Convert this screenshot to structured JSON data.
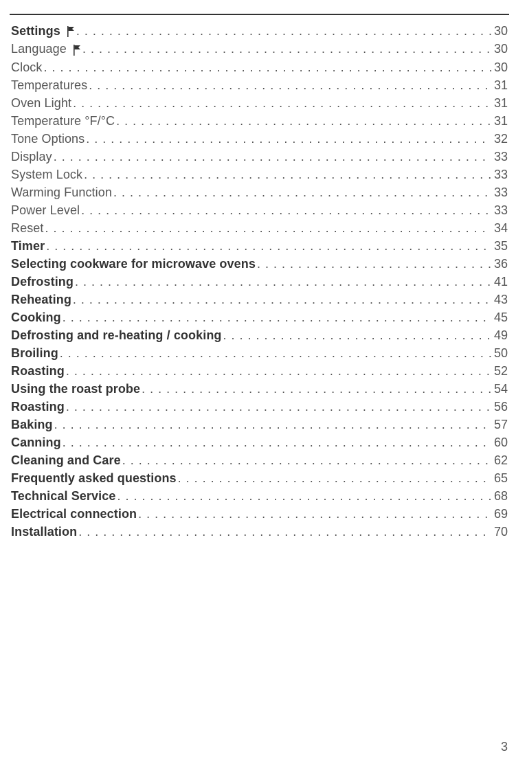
{
  "toc": [
    {
      "label": "Settings",
      "flag": true,
      "bold": true,
      "page": "30"
    },
    {
      "label": "Language",
      "flag": true,
      "bold": false,
      "page": "30"
    },
    {
      "label": "Clock",
      "flag": false,
      "bold": false,
      "page": "30"
    },
    {
      "label": "Temperatures",
      "flag": false,
      "bold": false,
      "page": "31"
    },
    {
      "label": "Oven Light",
      "flag": false,
      "bold": false,
      "page": "31"
    },
    {
      "label": "Temperature °F/°C",
      "flag": false,
      "bold": false,
      "page": "31"
    },
    {
      "label": "Tone Options",
      "flag": false,
      "bold": false,
      "page": "32"
    },
    {
      "label": "Display",
      "flag": false,
      "bold": false,
      "page": "33"
    },
    {
      "label": "System Lock",
      "flag": false,
      "bold": false,
      "page": "33"
    },
    {
      "label": "Warming Function",
      "flag": false,
      "bold": false,
      "page": "33"
    },
    {
      "label": "Power Level",
      "flag": false,
      "bold": false,
      "page": "33"
    },
    {
      "label": "Reset",
      "flag": false,
      "bold": false,
      "page": "34"
    },
    {
      "label": "Timer",
      "flag": false,
      "bold": true,
      "page": "35"
    },
    {
      "label": "Selecting cookware for microwave ovens",
      "flag": false,
      "bold": true,
      "page": "36"
    },
    {
      "label": "Defrosting",
      "flag": false,
      "bold": true,
      "page": "41"
    },
    {
      "label": "Reheating",
      "flag": false,
      "bold": true,
      "page": "43"
    },
    {
      "label": "Cooking",
      "flag": false,
      "bold": true,
      "page": "45"
    },
    {
      "label": "Defrosting and re-heating / cooking",
      "flag": false,
      "bold": true,
      "page": "49"
    },
    {
      "label": "Broiling",
      "flag": false,
      "bold": true,
      "page": "50"
    },
    {
      "label": "Roasting",
      "flag": false,
      "bold": true,
      "page": "52"
    },
    {
      "label": "Using the roast probe",
      "flag": false,
      "bold": true,
      "page": "54"
    },
    {
      "label": "Roasting",
      "flag": false,
      "bold": true,
      "page": "56"
    },
    {
      "label": "Baking",
      "flag": false,
      "bold": true,
      "page": "57"
    },
    {
      "label": "Canning",
      "flag": false,
      "bold": true,
      "page": "60"
    },
    {
      "label": "Cleaning and Care",
      "flag": false,
      "bold": true,
      "page": "62"
    },
    {
      "label": "Frequently asked questions",
      "flag": false,
      "bold": true,
      "page": "65"
    },
    {
      "label": "Technical Service",
      "flag": false,
      "bold": true,
      "page": "68"
    },
    {
      "label": "Electrical connection",
      "flag": false,
      "bold": true,
      "page": "69"
    },
    {
      "label": "Installation",
      "flag": false,
      "bold": true,
      "page": "70"
    }
  ],
  "page_number": "3"
}
